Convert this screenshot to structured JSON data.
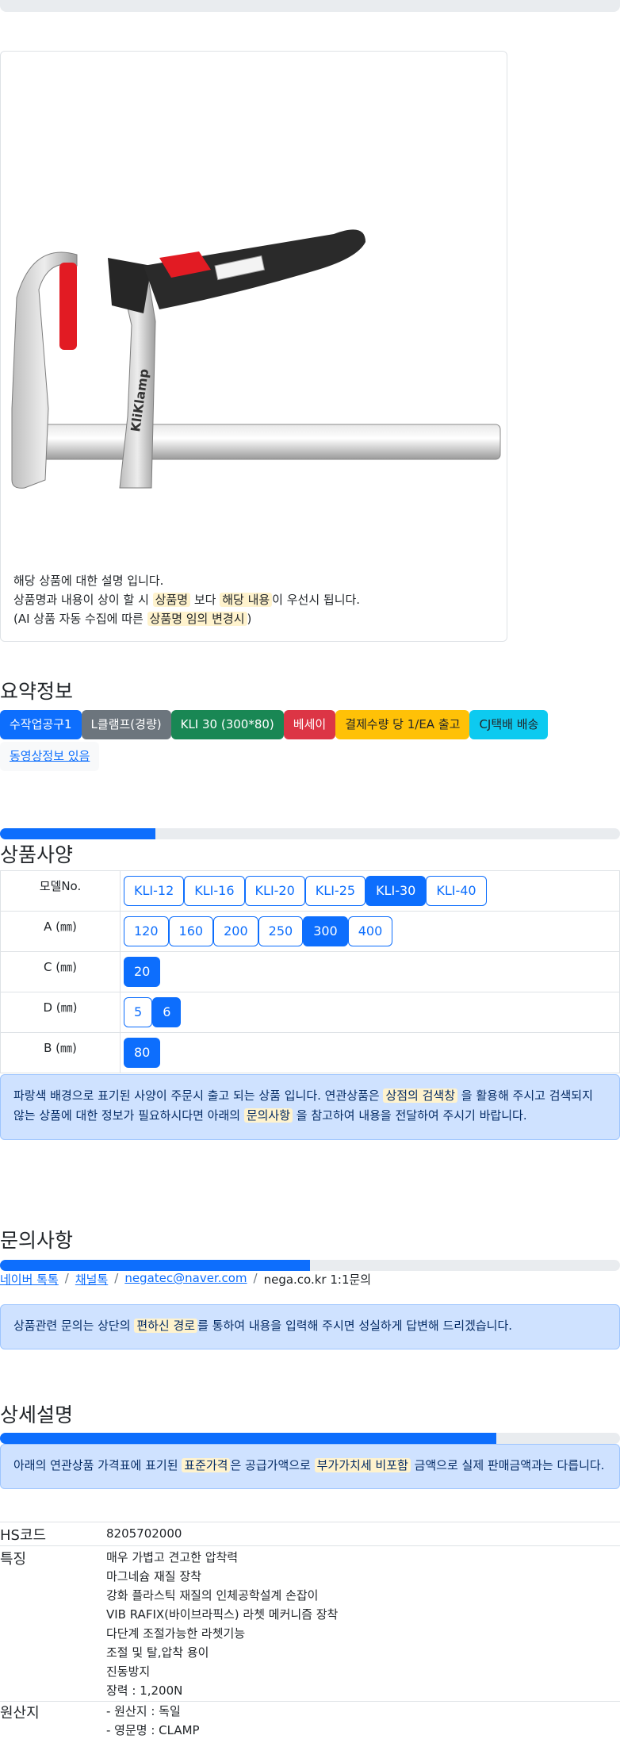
{
  "product": {
    "image_alt": "KliKlamp",
    "desc_line1": "해당 상품에 대한 설명 입니다.",
    "desc_line2_a": "상품명과 내용이 상이 할 시 ",
    "desc_line2_hl1": "상품명",
    "desc_line2_b": " 보다 ",
    "desc_line2_hl2": "해당 내용",
    "desc_line2_c": "이 우선시 됩니다.",
    "desc_line3_a": "(AI 상품 자동 수집에 따른 ",
    "desc_line3_hl": "상품명 임의 변경시",
    "desc_line3_b": ")"
  },
  "summary": {
    "title": "요약정보",
    "badges": [
      "수작업공구1",
      "L클램프(경량)",
      "KLI 30 (300*80)",
      "베세이",
      "결제수량 당 1/EA 출고",
      "CJ택배 배송"
    ],
    "video_link": "동영상정보 있음"
  },
  "spec": {
    "title": "상품사양",
    "progress": 0.25,
    "rows": [
      {
        "label": "모델No.",
        "options": [
          "KLI-12",
          "KLI-16",
          "KLI-20",
          "KLI-25",
          "KLI-30",
          "KLI-40"
        ],
        "selected": 4
      },
      {
        "label": "A (㎜)",
        "options": [
          "120",
          "160",
          "200",
          "250",
          "300",
          "400"
        ],
        "selected": 4
      },
      {
        "label": "C (㎜)",
        "options": [
          "20"
        ],
        "selected": 0
      },
      {
        "label": "D (㎜)",
        "options": [
          "5",
          "6"
        ],
        "selected": 1
      },
      {
        "label": "B (㎜)",
        "options": [
          "80"
        ],
        "selected": 0
      }
    ],
    "notice_a": "파랑색 배경으로 표기된 사양이 주문시 출고 되는 상품 입니다. 연관상품은 ",
    "notice_hl1": "상점의 검색창",
    "notice_b": " 을 활용해 주시고 검색되지 않는 상품에 대한 정보가 필요하시다면 아래의 ",
    "notice_hl2": "문의사항",
    "notice_c": " 을 참고하여 내용을 전달하여 주시기 바랍니다."
  },
  "inquiry": {
    "title": "문의사항",
    "progress": 0.5,
    "links": [
      "네이버 톡톡",
      "채널톡",
      "negatec@naver.com"
    ],
    "last": "nega.co.kr 1:1문의",
    "notice_a": "상품관련 문의는 상단의 ",
    "notice_hl": "편하신 경로",
    "notice_b": "를 통하여 내용을 입력해 주시면 성실하게 답변해 드리겠습니다."
  },
  "detail": {
    "title": "상세설명",
    "progress": 0.8,
    "notice_a": "아래의 연관상품 가격표에 표기된 ",
    "notice_hl1": "표준가격",
    "notice_b": "은 공급가액으로 ",
    "notice_hl2": "부가가치세 비포함",
    "notice_c": " 금액으로 실제 판매금액과는 다릅니다.",
    "hs_key": "HS코드",
    "hs_val": "8205702000",
    "feature_key": "특징",
    "features": [
      "매우 가볍고 견고한 압착력",
      "마그네슘 재질 장착",
      "강화 플라스틱 재질의 인체공학설계 손잡이",
      "VIB RAFIX(바이브라픽스) 라쳇 메커니즘 장착",
      "다단계 조절가능한 라쳇기능",
      "조절 및 탈,압착 용이",
      "진동방지",
      "장력 : 1,200N"
    ],
    "origin_key": "원산지",
    "origins": [
      "- 원산지 : 독일",
      "- 영문명 : CLAMP"
    ]
  }
}
